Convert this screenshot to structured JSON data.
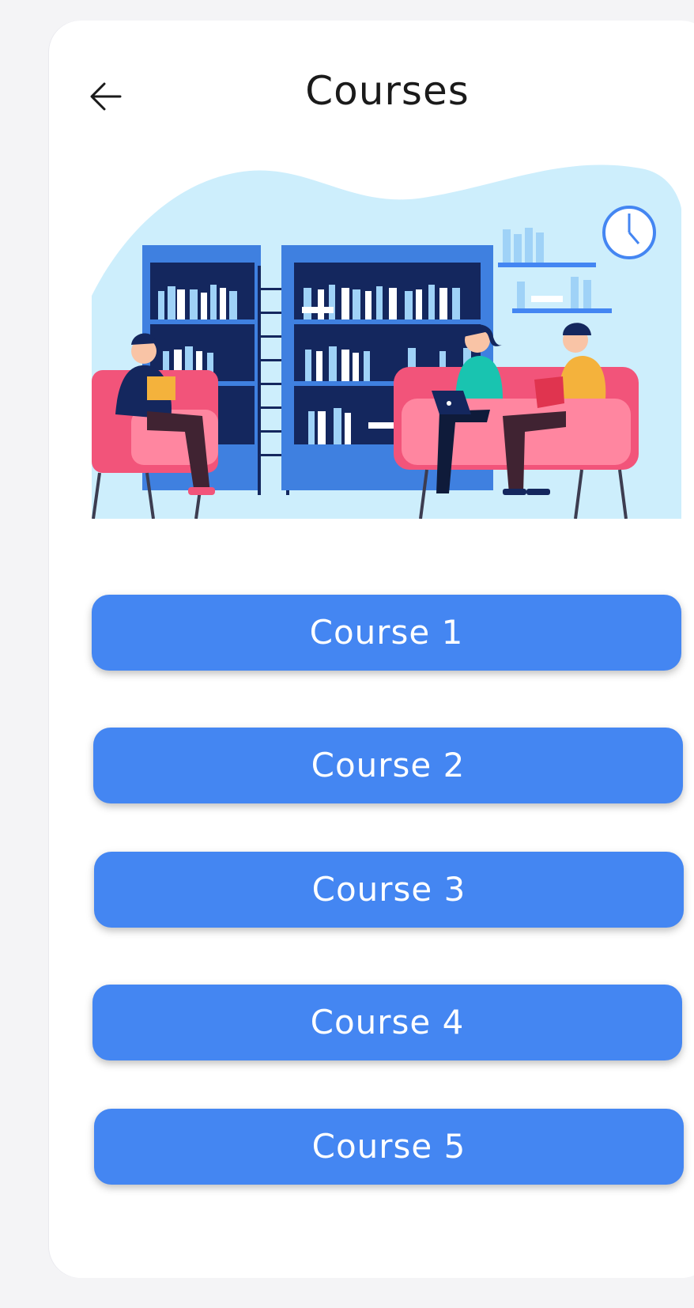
{
  "header": {
    "title": "Courses",
    "back_icon": "arrow-left-icon"
  },
  "illustration": {
    "subject": "library-study-scene",
    "colors": {
      "background": "#cdeefc",
      "shelf": "#3f80e0",
      "shelf_inner": "#14275e",
      "sofa": "#f2547a"
    }
  },
  "courses": [
    {
      "label": "Course 1"
    },
    {
      "label": "Course 2"
    },
    {
      "label": "Course 3"
    },
    {
      "label": "Course 4"
    },
    {
      "label": "Course 5"
    }
  ],
  "colors": {
    "accent": "#4486f2",
    "text": "#1a1a1a"
  }
}
